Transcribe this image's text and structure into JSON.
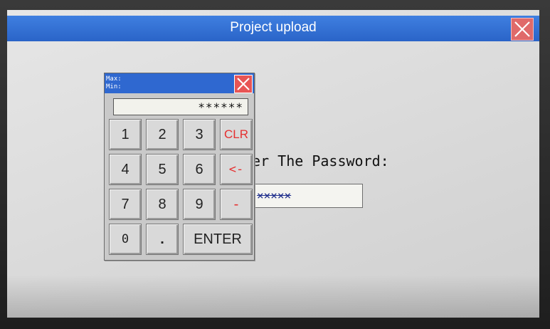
{
  "window": {
    "title": "Project upload"
  },
  "prompt": {
    "text": "ter The Password:"
  },
  "password_field": {
    "value": "×××××"
  },
  "keypad": {
    "max_label": "Max:",
    "min_label": "Min:",
    "display": "******",
    "keys": [
      {
        "label": "1"
      },
      {
        "label": "2"
      },
      {
        "label": "3"
      },
      {
        "label": "CLR"
      },
      {
        "label": "4"
      },
      {
        "label": "5"
      },
      {
        "label": "6"
      },
      {
        "label": "<-"
      },
      {
        "label": "7"
      },
      {
        "label": "8"
      },
      {
        "label": "9"
      },
      {
        "label": "-"
      },
      {
        "label": "0"
      },
      {
        "label": "."
      },
      {
        "label": "ENTER"
      }
    ]
  },
  "icons": {
    "close_main": "close-icon",
    "close_keypad": "close-icon"
  },
  "colors": {
    "titlebar": "#2a64c8",
    "close": "#e85555",
    "accent_keys": "#e53030"
  }
}
